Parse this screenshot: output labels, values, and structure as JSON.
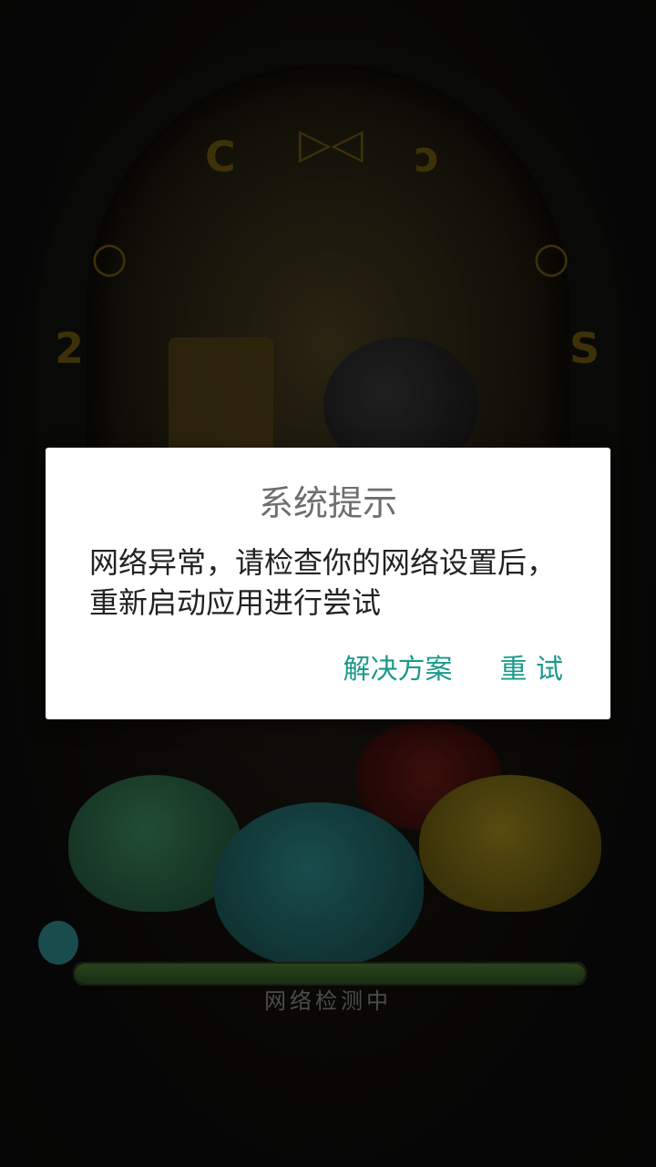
{
  "dialog": {
    "title": "系统提示",
    "message": "网络异常，请检查你的网络设置后，重新启动应用进行尝试",
    "solution_label": "解决方案",
    "retry_label": "重 试"
  },
  "loading": {
    "label": "网络检测中",
    "progress": 1.0
  },
  "colors": {
    "accent": "#1b9a8a",
    "title_text": "#6e6e6e",
    "body_text": "#222222"
  }
}
